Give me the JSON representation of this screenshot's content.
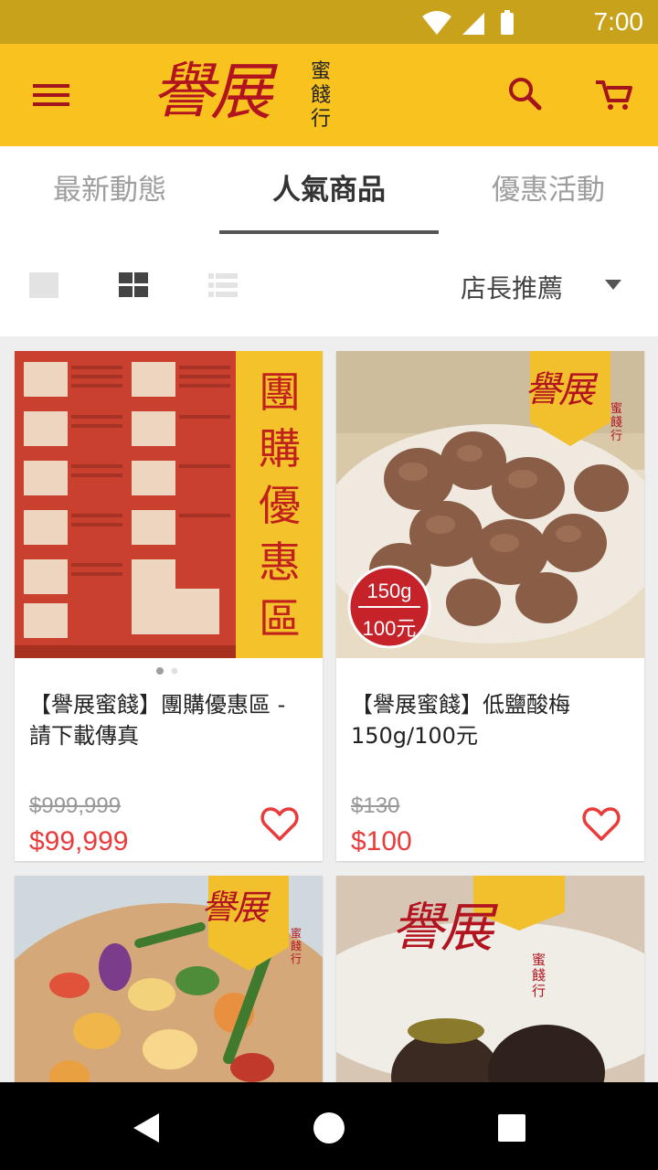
{
  "status_bar": {
    "time": "7:00",
    "icons": [
      "wifi-icon",
      "signal-icon",
      "battery-icon"
    ]
  },
  "app_bar": {
    "logo_main": "譽展",
    "logo_side": "蜜餞行",
    "icons": [
      "menu-icon",
      "search-icon",
      "cart-icon"
    ]
  },
  "tabs": [
    {
      "label": "最新動態",
      "active": false
    },
    {
      "label": "人氣商品",
      "active": true
    },
    {
      "label": "優惠活動",
      "active": false
    }
  ],
  "toolbar": {
    "views": [
      "single-view-icon",
      "grid-view-icon",
      "list-view-icon"
    ],
    "sort_label": "店長推薦"
  },
  "products": [
    {
      "title": "【譽展蜜餞】團購優惠區 - 請下載傳真",
      "original_price": "$999,999",
      "price": "$99,999",
      "image_text": "團購優惠區",
      "carousel_pages": 2,
      "carousel_current": 1
    },
    {
      "title": "【譽展蜜餞】低鹽酸梅 150g/100元",
      "original_price": "$130",
      "price": "$100",
      "badge_top": "150g",
      "badge_bottom": "100元",
      "logo_main": "譽展",
      "logo_side": "蜜餞行"
    },
    {
      "title": "",
      "logo_main": "譽展",
      "logo_side": "蜜餞行"
    },
    {
      "title": "",
      "logo_main": "譽展",
      "logo_side": "蜜餞行"
    }
  ],
  "colors": {
    "status_bar": "#c9a21c",
    "app_bar": "#f8c21f",
    "brand_red": "#b2141f",
    "price_red": "#ea3b3b"
  }
}
